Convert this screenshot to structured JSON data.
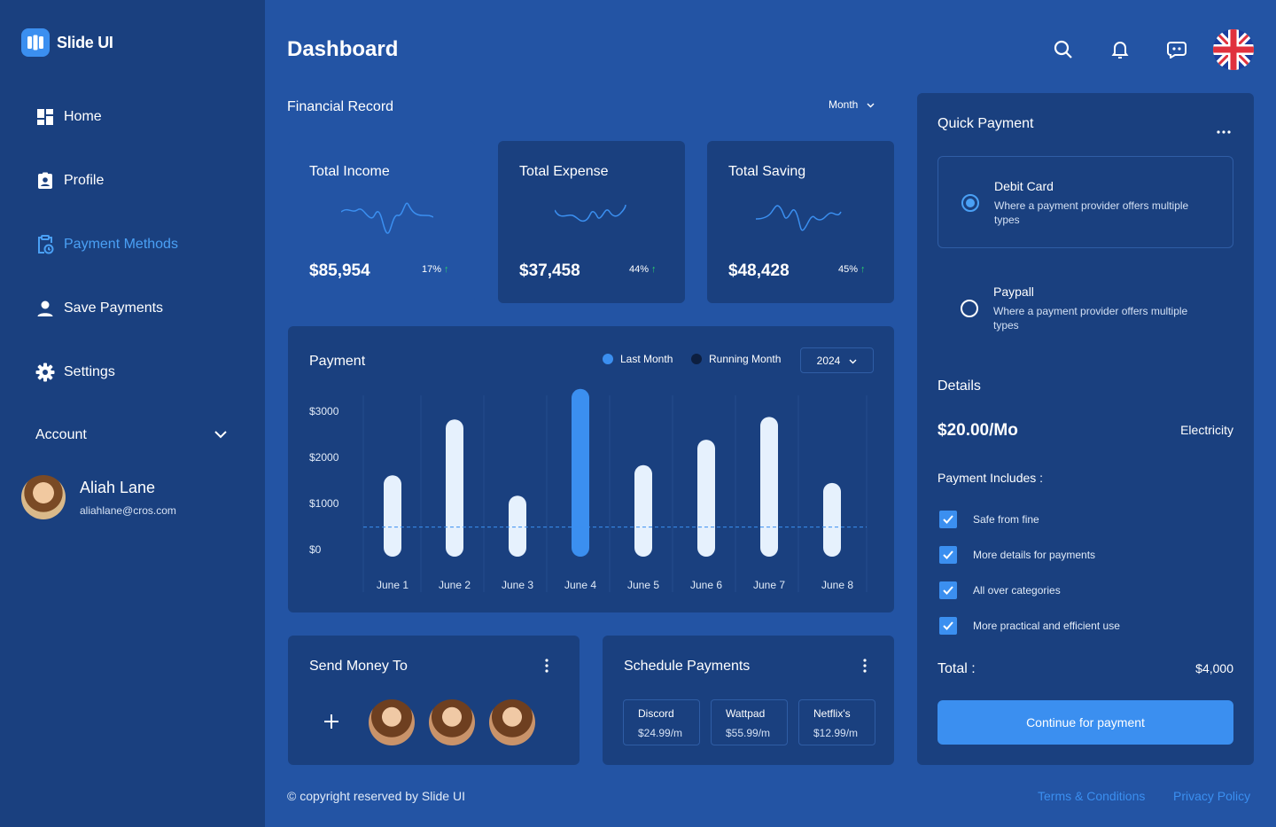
{
  "app": {
    "name": "Slide UI",
    "logo_icon": "slides-logo-icon"
  },
  "sidebar": {
    "items": [
      {
        "label": "Home",
        "icon": "dashboard-grid-icon",
        "active": false
      },
      {
        "label": "Profile",
        "icon": "id-badge-icon",
        "active": false
      },
      {
        "label": "Payment Methods",
        "icon": "clipboard-clock-icon",
        "active": true
      },
      {
        "label": "Save Payments",
        "icon": "person-icon",
        "active": false
      },
      {
        "label": "Settings",
        "icon": "gear-icon",
        "active": false
      }
    ],
    "account_label": "Account",
    "user": {
      "name": "Aliah Lane",
      "email": "aliahlane@cros.com"
    }
  },
  "header": {
    "title": "Dashboard",
    "icons": [
      "search-icon",
      "bell-icon",
      "chat-icon",
      "uk-flag-icon"
    ]
  },
  "financial": {
    "title": "Financial Record",
    "period": "Month",
    "cards": [
      {
        "label": "Total Income",
        "value": "$85,954",
        "change": "17%"
      },
      {
        "label": "Total Expense",
        "value": "$37,458",
        "change": "44%"
      },
      {
        "label": "Total Saving",
        "value": "$48,428",
        "change": "45%"
      }
    ]
  },
  "payment_chart": {
    "title": "Payment",
    "legend": [
      "Last Month",
      "Running Month"
    ],
    "year": "2024"
  },
  "chart_data": {
    "type": "bar",
    "title": "Payment",
    "categories": [
      "June 1",
      "June 2",
      "June 3",
      "June 4",
      "June 5",
      "June 6",
      "June 7",
      "June 8"
    ],
    "values": [
      1600,
      2700,
      1200,
      3300,
      1800,
      2300,
      2750,
      1450
    ],
    "highlight_index": 3,
    "yticks": [
      "$3000",
      "$2000",
      "$1000",
      "$0"
    ],
    "ylim": [
      0,
      3000
    ],
    "reference_line": 1000,
    "colors": {
      "bar": "#e6f1fd",
      "highlight": "#3b8ff0",
      "reference": "#3b8ff0"
    }
  },
  "send_money": {
    "title": "Send Money To",
    "add_icon": "plus-icon",
    "contacts": 3
  },
  "schedule": {
    "title": "Schedule Payments",
    "items": [
      {
        "name": "Discord",
        "price": "$24.99/m"
      },
      {
        "name": "Wattpad",
        "price": "$55.99/m"
      },
      {
        "name": "Netflix's",
        "price": "$12.99/m"
      }
    ]
  },
  "quick_payment": {
    "title": "Quick Payment",
    "options": [
      {
        "name": "Debit Card",
        "desc": "Where a payment provider offers multiple types",
        "selected": true
      },
      {
        "name": "Paypall",
        "desc": "Where a payment provider offers multiple types",
        "selected": false
      }
    ],
    "details_title": "Details",
    "price": "$20.00/Mo",
    "category": "Electricity",
    "includes_title": "Payment Includes :",
    "includes": [
      "Safe from fine",
      "More details for payments",
      "All over categories",
      "More practical and efficient use"
    ],
    "total_label": "Total :",
    "total_value": "$4,000",
    "cta": "Continue for payment"
  },
  "footer": {
    "copyright": "© copyright reserved by Slide UI",
    "links": [
      "Terms & Conditions",
      "Privacy Policy"
    ]
  },
  "colors": {
    "accent": "#3b8ff0",
    "sidebar": "#1a407f",
    "background": "#2354a4",
    "positive": "#2bd26c"
  }
}
